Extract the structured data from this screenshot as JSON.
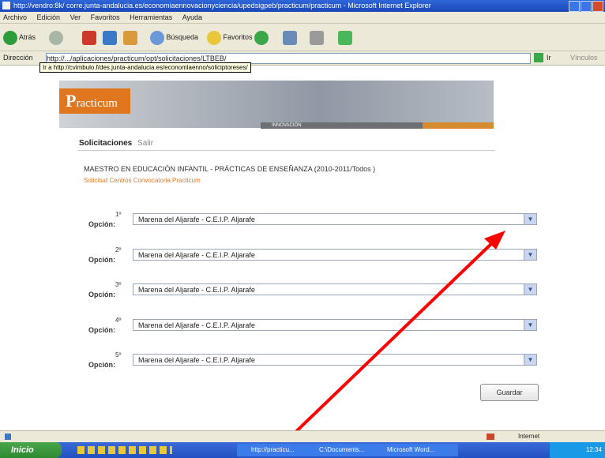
{
  "window": {
    "title": "http://vendro:8k/ corre.junta-andalucia.es/economiaennovacionyciencia/upedsigpeb/practicum/practicum - Microsoft Internet Explorer"
  },
  "menu": [
    "Archivo",
    "Edición",
    "Ver",
    "Favoritos",
    "Herramientas",
    "Ayuda"
  ],
  "toolbar": {
    "back_label": "Atrás",
    "search_label": "Búsqueda",
    "favorites_label": "Favoritos"
  },
  "address": {
    "label": "Dirección",
    "value": "http://.../aplicaciones/practicum/opt/solicitaciones/LTBEB/",
    "go_label": "Ir",
    "links_label": "Vínculos",
    "tooltip": "Ir a http://cvimbulo.f/des.junta-andalucia.es/economiaenno/soliciptoreses/"
  },
  "page": {
    "logo_text": "racticum",
    "logo_initial": "P",
    "banner_label": "INNOVACIÓN",
    "tabs": {
      "active": "Solicitaciones",
      "other": "Salir"
    },
    "heading": "MAESTRO EN EDUCACIÓN INFANTIL - PRÁCTICAS DE ENSEÑANZA (2010-2011/Todos )",
    "subheading": "Solicitud Centros Convocatoria Practicum",
    "options": [
      {
        "num": "1º",
        "label": "Opción:",
        "value": "Marena del Aljarafe - C.E.I.P. Aljarafe"
      },
      {
        "num": "2º",
        "label": "Opción:",
        "value": "Marena del Aljarafe - C.E.I.P. Aljarafe"
      },
      {
        "num": "3º",
        "label": "Opción:",
        "value": "Marena del Aljarafe - C.E.I.P. Aljarafe"
      },
      {
        "num": "4º",
        "label": "Opción:",
        "value": "Marena del Aljarafe - C.E.I.P. Aljarafe"
      },
      {
        "num": "5º",
        "label": "Opción:",
        "value": "Marena del Aljarafe - C.E.I.P. Aljarafe"
      }
    ],
    "submit_label": "Guardar"
  },
  "status": {
    "zone": "Internet"
  },
  "taskbar": {
    "start_label": "Inicio",
    "tasks": [
      "http://practicu...",
      "C:\\Documents...",
      "Microsoft Word..."
    ],
    "clock": "12:34"
  },
  "annotation": {
    "color": "#ff0000"
  }
}
